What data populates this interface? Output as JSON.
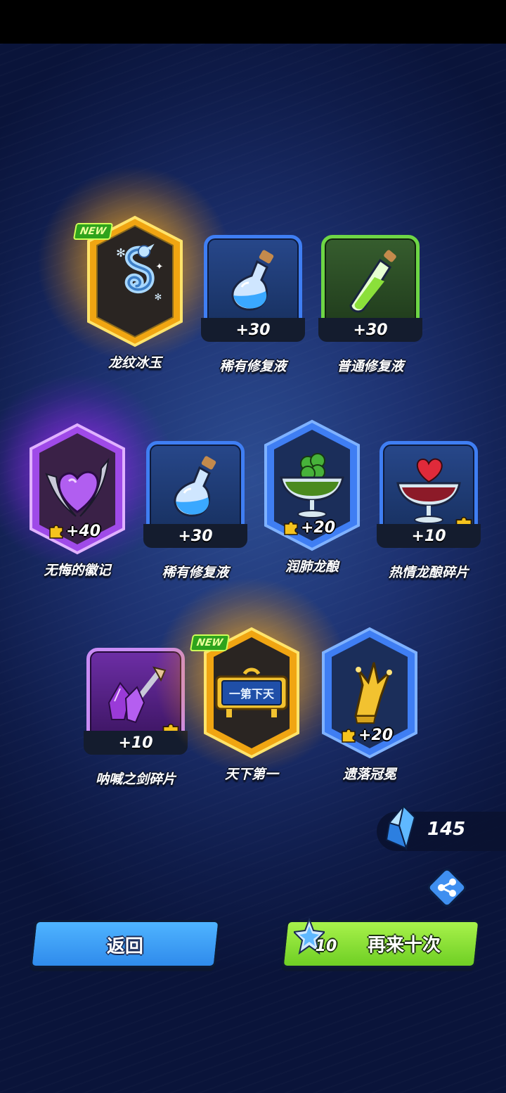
{
  "colors": {
    "rarity_gold": "#f2b21b",
    "rarity_purple": "#b05cf2",
    "rarity_blue": "#3f7ef3",
    "rarity_green": "#6ed645",
    "button_back": "#3a9ef2",
    "button_again": "#86df32"
  },
  "rows": [
    [
      {
        "name": "龙纹冰玉",
        "count": "",
        "is_new": true,
        "new_label": "NEW",
        "frame": "hex",
        "rarity": "gold",
        "glow": "gold",
        "icon": "ice-dragon-icon",
        "fragment": false
      },
      {
        "name": "稀有修复液",
        "count": "+30",
        "is_new": false,
        "frame": "square",
        "rarity": "blue",
        "icon": "blue-potion-icon",
        "fragment": false
      },
      {
        "name": "普通修复液",
        "count": "+30",
        "is_new": false,
        "frame": "square",
        "rarity": "green",
        "icon": "green-potion-icon",
        "fragment": false
      }
    ],
    [
      {
        "name": "无悔的徽记",
        "count": "+40",
        "is_new": false,
        "frame": "hex",
        "rarity": "purple",
        "glow": "purple",
        "icon": "purple-heart-emblem-icon",
        "fragment": true
      },
      {
        "name": "稀有修复液",
        "count": "+30",
        "is_new": false,
        "frame": "square",
        "rarity": "blue",
        "icon": "blue-potion-icon",
        "fragment": false
      },
      {
        "name": "润肺龙酿",
        "count": "+20",
        "is_new": false,
        "frame": "hex",
        "rarity": "blue",
        "icon": "green-cocktail-icon",
        "fragment": true
      },
      {
        "name": "热情龙酿碎片",
        "count": "+10",
        "is_new": false,
        "frame": "square",
        "rarity": "blue",
        "icon": "heart-cocktail-icon",
        "fragment": true
      }
    ],
    [
      {
        "name": "呐喊之剑碎片",
        "count": "+10",
        "is_new": false,
        "frame": "square",
        "rarity": "purple",
        "icon": "crystal-sword-icon",
        "fragment": true
      },
      {
        "name": "天下第一",
        "count": "",
        "is_new": true,
        "new_label": "NEW",
        "frame": "hex",
        "rarity": "gold",
        "glow": "gold",
        "icon": "title-plaque-icon",
        "plaque_text": "一第下天",
        "fragment": false
      },
      {
        "name": "遗落冠冕",
        "count": "+20",
        "is_new": false,
        "frame": "hex",
        "rarity": "blue",
        "icon": "golden-crown-icon",
        "fragment": true
      }
    ]
  ],
  "currency": {
    "amount": "145",
    "icon": "crystal-icon"
  },
  "share": {
    "icon": "share-icon"
  },
  "buttons": {
    "back_label": "返回",
    "again_label": "再来十次",
    "again_cost": "10",
    "again_cost_icon": "star-crystal-icon"
  }
}
